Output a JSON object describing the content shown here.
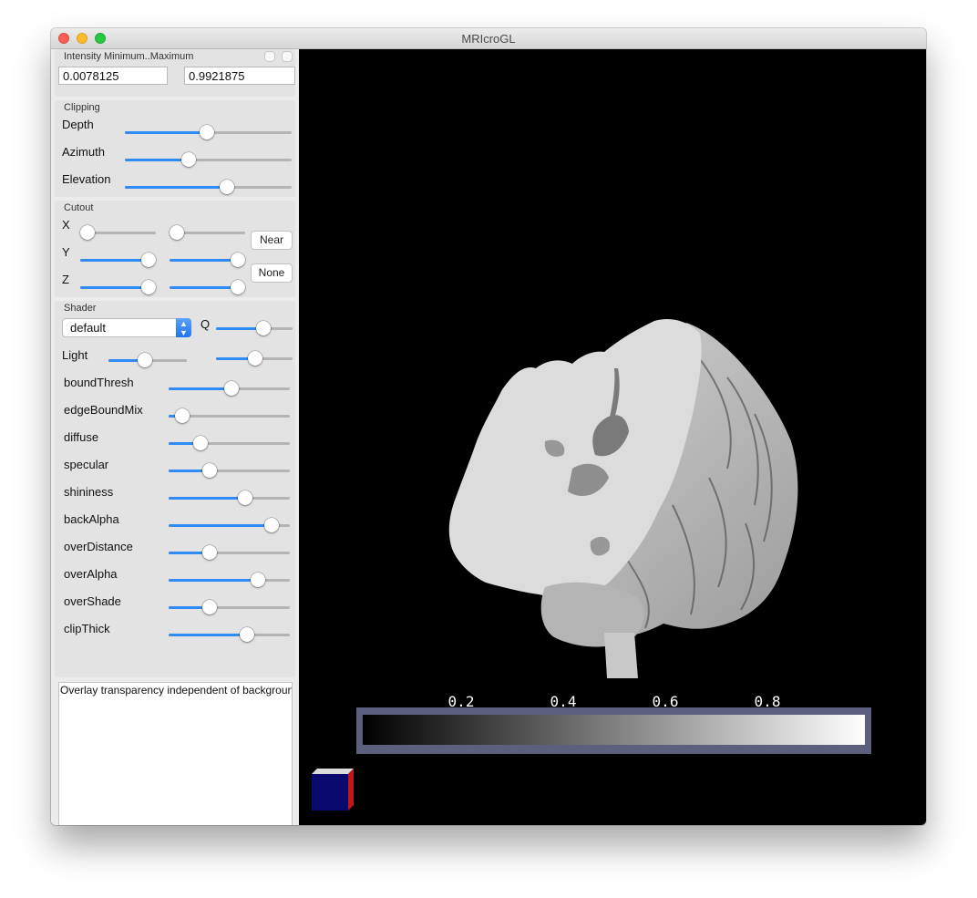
{
  "window": {
    "title": "MRIcroGL"
  },
  "intensity": {
    "title": "Intensity Minimum..Maximum",
    "min_value": "0.0078125",
    "max_value": "0.9921875"
  },
  "clipping": {
    "title": "Clipping",
    "depth_label": "Depth",
    "depth_value": 0.49,
    "azimuth_label": "Azimuth",
    "azimuth_value": 0.37,
    "elevation_label": "Elevation",
    "elevation_value": 0.62
  },
  "cutout": {
    "title": "Cutout",
    "x_label": "X",
    "y_label": "Y",
    "z_label": "Z",
    "x_low": 0.0,
    "x_high": 0.0,
    "y_low": 1.0,
    "y_high": 1.0,
    "z_low": 1.0,
    "z_high": 1.0,
    "near_label": "Near",
    "none_label": "None"
  },
  "shader": {
    "title": "Shader",
    "selected": "default",
    "q_label": "Q",
    "q_value": 0.65,
    "light_label": "Light",
    "light_a": 0.45,
    "light_b": 0.52,
    "params": [
      {
        "label": "boundThresh",
        "value": 0.52
      },
      {
        "label": "edgeBoundMix",
        "value": 0.06
      },
      {
        "label": "diffuse",
        "value": 0.23
      },
      {
        "label": "specular",
        "value": 0.32
      },
      {
        "label": "shininess",
        "value": 0.65
      },
      {
        "label": "backAlpha",
        "value": 0.9
      },
      {
        "label": "overDistance",
        "value": 0.32
      },
      {
        "label": "overAlpha",
        "value": 0.77
      },
      {
        "label": "overShade",
        "value": 0.32
      },
      {
        "label": "clipThick",
        "value": 0.67
      }
    ]
  },
  "hint_text": "Overlay transparency independent of background",
  "colorbar": {
    "ticks": [
      "0.2",
      "0.4",
      "0.6",
      "0.8"
    ]
  },
  "colors": {
    "accent": "#2f8bf5",
    "background": "#000000",
    "colorbar_frame": "#5d5f7e"
  }
}
